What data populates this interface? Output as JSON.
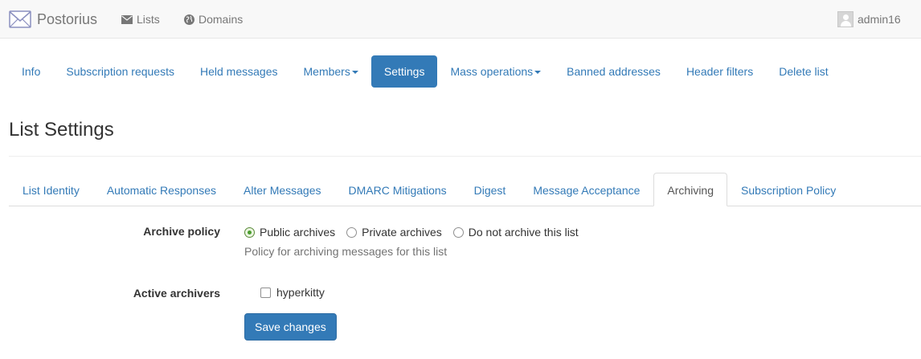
{
  "brand": {
    "name": "Postorius",
    "icon": "envelope-icon"
  },
  "topnav": {
    "lists": {
      "label": "Lists",
      "icon": "envelope-icon"
    },
    "domains": {
      "label": "Domains",
      "icon": "globe-icon"
    },
    "user": {
      "label": "admin16",
      "icon": "avatar-icon"
    }
  },
  "list_nav": [
    {
      "label": "Info"
    },
    {
      "label": "Subscription requests"
    },
    {
      "label": "Held messages"
    },
    {
      "label": "Members",
      "dropdown": true
    },
    {
      "label": "Settings",
      "active": true
    },
    {
      "label": "Mass operations",
      "dropdown": true
    },
    {
      "label": "Banned addresses"
    },
    {
      "label": "Header filters"
    },
    {
      "label": "Delete list"
    }
  ],
  "page": {
    "title": "List Settings"
  },
  "settings_tabs": [
    {
      "label": "List Identity"
    },
    {
      "label": "Automatic Responses"
    },
    {
      "label": "Alter Messages"
    },
    {
      "label": "DMARC Mitigations"
    },
    {
      "label": "Digest"
    },
    {
      "label": "Message Acceptance"
    },
    {
      "label": "Archiving",
      "active": true
    },
    {
      "label": "Subscription Policy"
    }
  ],
  "form": {
    "archive_policy": {
      "label": "Archive policy",
      "options": [
        {
          "label": "Public archives",
          "checked": true
        },
        {
          "label": "Private archives",
          "checked": false
        },
        {
          "label": "Do not archive this list",
          "checked": false
        }
      ],
      "help": "Policy for archiving messages for this list"
    },
    "active_archivers": {
      "label": "Active archivers",
      "options": [
        {
          "label": "hyperkitty",
          "checked": false
        }
      ]
    },
    "submit_label": "Save changes"
  },
  "colors": {
    "link": "#337ab7",
    "navbar_bg": "#f8f8f8",
    "radio_checked": "#4a9d2e"
  }
}
